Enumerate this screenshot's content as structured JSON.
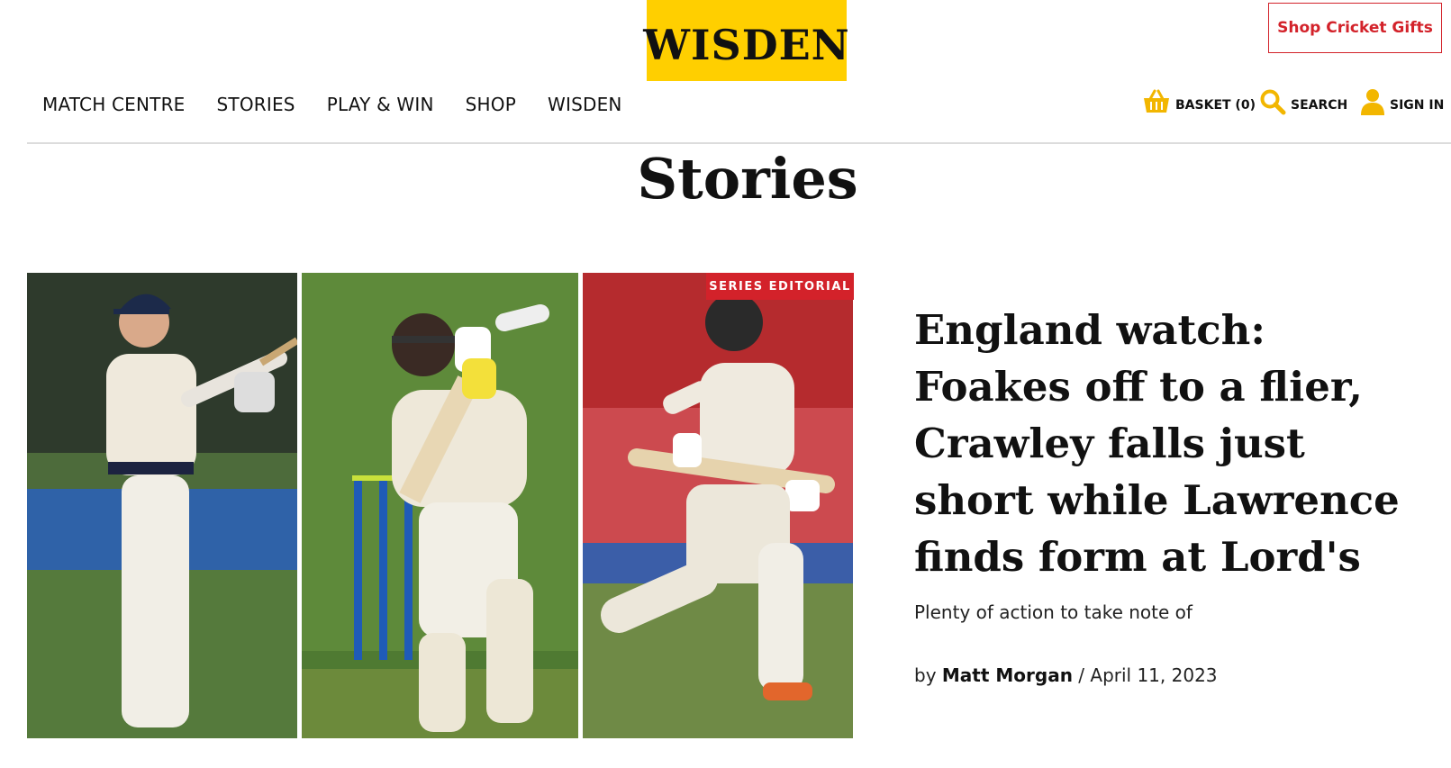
{
  "header": {
    "logo_text": "WISDEN",
    "gift_button": "Shop Cricket Gifts",
    "brand_yellow": "#ffcf00",
    "accent_red": "#d3222a"
  },
  "nav": {
    "items": [
      {
        "label": "MATCH CENTRE"
      },
      {
        "label": "STORIES"
      },
      {
        "label": "PLAY & WIN"
      },
      {
        "label": "SHOP"
      },
      {
        "label": "WISDEN"
      }
    ]
  },
  "utility": {
    "basket": {
      "label": "BASKET (0)",
      "icon": "basket-icon"
    },
    "search": {
      "label": "SEARCH",
      "icon": "search-icon"
    },
    "signin": {
      "label": "SIGN IN",
      "icon": "user-icon"
    }
  },
  "page": {
    "title": "Stories"
  },
  "feature": {
    "badge": "SERIES EDITORIAL",
    "headline": "England watch: Foakes off to a flier, Crawley falls just short while Lawrence finds form at Lord's",
    "standfirst": "Plenty of action to take note of",
    "byline_prefix": "by",
    "author": "Matt Morgan",
    "separator": " / ",
    "date": "April 11, 2023"
  }
}
